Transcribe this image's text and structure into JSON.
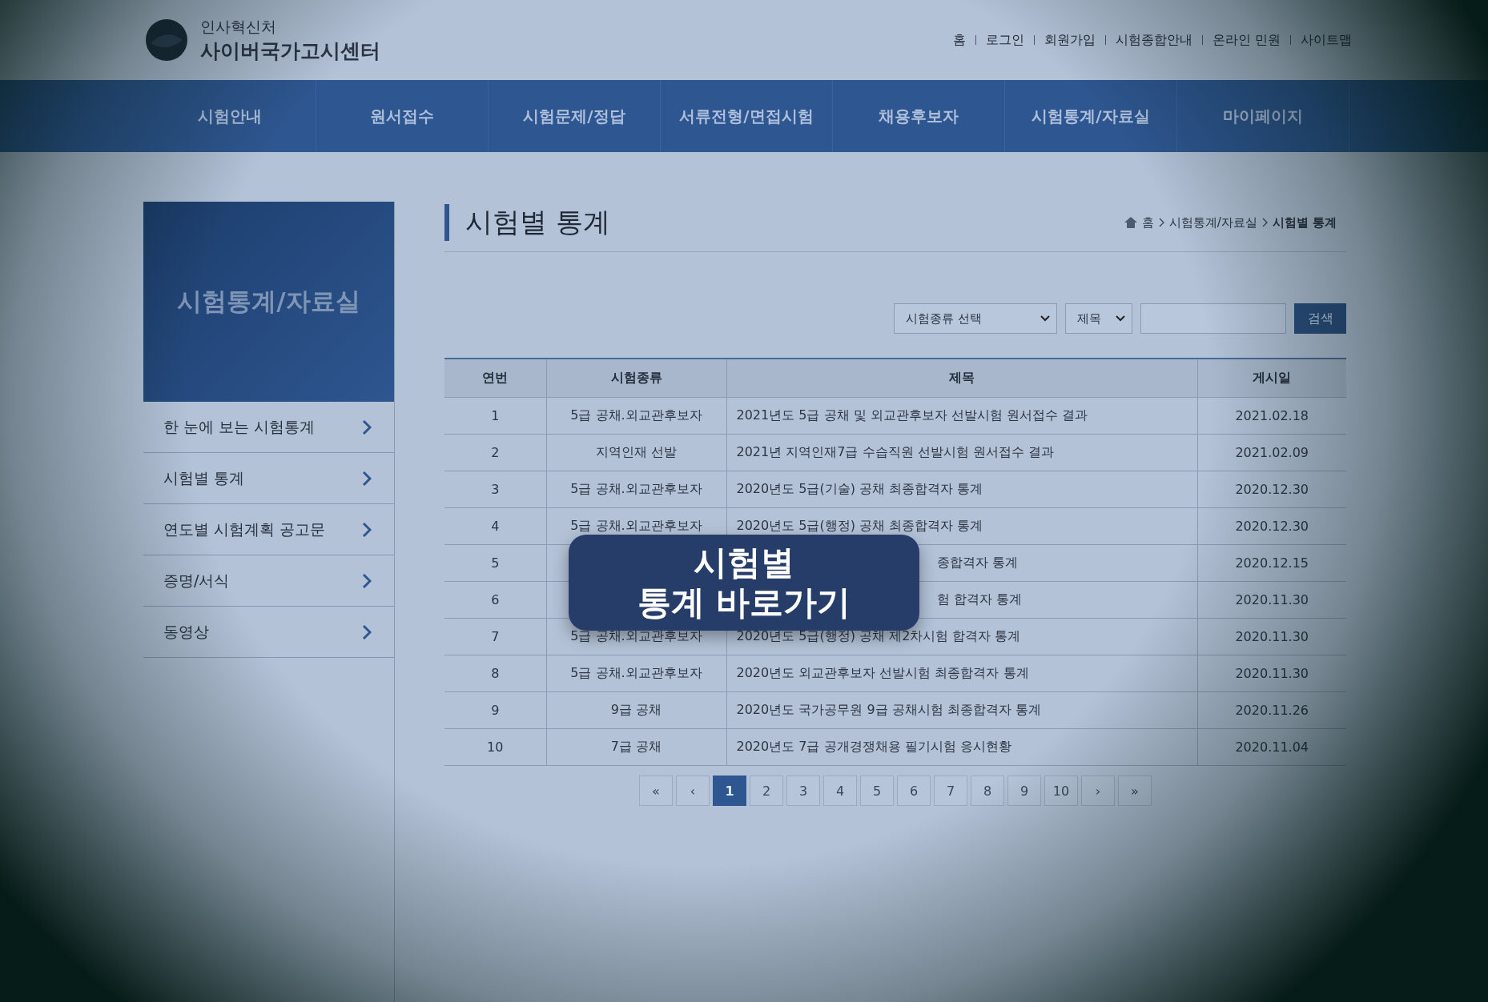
{
  "logo": {
    "org": "인사혁신처",
    "title": "사이버국가고시센터"
  },
  "top_links": [
    "홈",
    "로그인",
    "회원가입",
    "시험종합안내",
    "온라인 민원",
    "사이트맵"
  ],
  "nav": [
    "시험안내",
    "원서접수",
    "시험문제/정답",
    "서류전형/면접시험",
    "채용후보자",
    "시험통계/자료실",
    "마이페이지"
  ],
  "sidebar": {
    "title": "시험통계/자료실",
    "items": [
      "한 눈에 보는 시험통계",
      "시험별 통계",
      "연도별 시험계획 공고문",
      "증명/서식",
      "동영상"
    ]
  },
  "page_title": "시험별 통계",
  "breadcrumb": [
    "홈",
    "시험통계/자료실",
    "시험별 통계"
  ],
  "search": {
    "category": "시험종류 선택",
    "field": "제목",
    "button": "검색"
  },
  "table": {
    "columns": [
      "연번",
      "시험종류",
      "제목",
      "게시일"
    ],
    "rows": [
      {
        "no": "1",
        "type": "5급 공채.외교관후보자",
        "title": "2021년도 5급 공채 및 외교관후보자 선발시험 원서접수 결과",
        "date": "2021.02.18",
        "covered": false
      },
      {
        "no": "2",
        "type": "지역인재 선발",
        "title": "2021년 지역인재7급 수습직원 선발시험 원서접수 결과",
        "date": "2021.02.09",
        "covered": false
      },
      {
        "no": "3",
        "type": "5급 공채.외교관후보자",
        "title": "2020년도 5급(기술) 공채 최종합격자 통계",
        "date": "2020.12.30",
        "covered": false
      },
      {
        "no": "4",
        "type": "5급 공채.외교관후보자",
        "title": "2020년도 5급(행정) 공채 최종합격자 통계",
        "date": "2020.12.30",
        "covered": false
      },
      {
        "no": "5",
        "title": "종합격자 통계",
        "date": "2020.12.15",
        "covered": true
      },
      {
        "no": "6",
        "title": "험 합격자 통계",
        "date": "2020.11.30",
        "covered": true
      },
      {
        "no": "7",
        "type": "5급 공채.외교관후보자",
        "title": "2020년도 5급(행정) 공채 제2차시험 합격자 통계",
        "date": "2020.11.30",
        "covered": false
      },
      {
        "no": "8",
        "type": "5급 공채.외교관후보자",
        "title": "2020년도 외교관후보자 선발시험 최종합격자 통계",
        "date": "2020.11.30",
        "covered": false
      },
      {
        "no": "9",
        "type": "9급 공채",
        "title": "2020년도 국가공무원 9급 공채시험 최종합격자 통계",
        "date": "2020.11.26",
        "covered": false
      },
      {
        "no": "10",
        "type": "7급 공채",
        "title": "2020년도 7급 공개경쟁채용 필기시험 응시현황",
        "date": "2020.11.04",
        "covered": false
      }
    ]
  },
  "pagination": {
    "first": "«",
    "prev": "‹",
    "pages": [
      {
        "label": "1",
        "selected": true
      },
      {
        "label": "2",
        "selected": false
      },
      {
        "label": "3",
        "selected": false
      },
      {
        "label": "4",
        "selected": false
      },
      {
        "label": "5",
        "selected": false
      },
      {
        "label": "6",
        "selected": false
      },
      {
        "label": "7",
        "selected": false
      },
      {
        "label": "8",
        "selected": false
      },
      {
        "label": "9",
        "selected": false
      },
      {
        "label": "10",
        "selected": false
      }
    ],
    "next": "›",
    "last": "»"
  },
  "callout": {
    "lines": [
      "시험별",
      "통계 바로가기"
    ]
  }
}
